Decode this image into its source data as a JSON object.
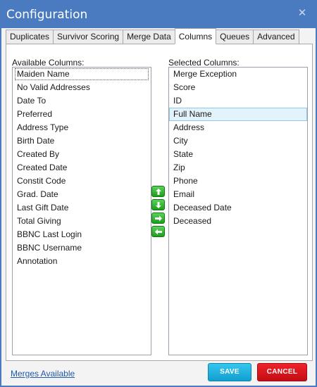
{
  "window": {
    "title": "Configuration",
    "close_glyph": "✕",
    "colors": {
      "titlebar": "#4a7bc0",
      "save": "#1cb0df",
      "cancel": "#e0151d",
      "link": "#1e5aa8"
    }
  },
  "tabs": [
    {
      "label": "Duplicates",
      "active": false
    },
    {
      "label": "Survivor Scoring",
      "active": false
    },
    {
      "label": "Merge Data",
      "active": false
    },
    {
      "label": "Columns",
      "active": true
    },
    {
      "label": "Queues",
      "active": false
    },
    {
      "label": "Advanced",
      "active": false
    }
  ],
  "available": {
    "label": "Available Columns:",
    "items": [
      "Maiden Name",
      "No Valid Addresses",
      "Date To",
      "Preferred",
      "Address Type",
      "Birth Date",
      "Created By",
      "Created Date",
      "Constit Code",
      "Grad. Date",
      "Last Gift Date",
      "Total Giving",
      "BBNC Last Login",
      "BBNC Username",
      "Annotation"
    ],
    "focused_item": "Maiden Name"
  },
  "selected": {
    "label": "Selected Columns:",
    "items": [
      "Merge Exception",
      "Score",
      "ID",
      "Full Name",
      "Address",
      "City",
      "State",
      "Zip",
      "Phone",
      "Email",
      "Deceased Date",
      "Deceased"
    ],
    "highlighted_item": "Full Name"
  },
  "arrow_buttons": [
    {
      "name": "move-up-button",
      "icon": "arrow-up-icon"
    },
    {
      "name": "move-down-button",
      "icon": "arrow-down-icon"
    },
    {
      "name": "add-column-button",
      "icon": "arrow-right-icon"
    },
    {
      "name": "remove-column-button",
      "icon": "arrow-left-icon"
    }
  ],
  "footer": {
    "link": "Merges Available",
    "save_label": "SAVE",
    "cancel_label": "CANCEL"
  }
}
